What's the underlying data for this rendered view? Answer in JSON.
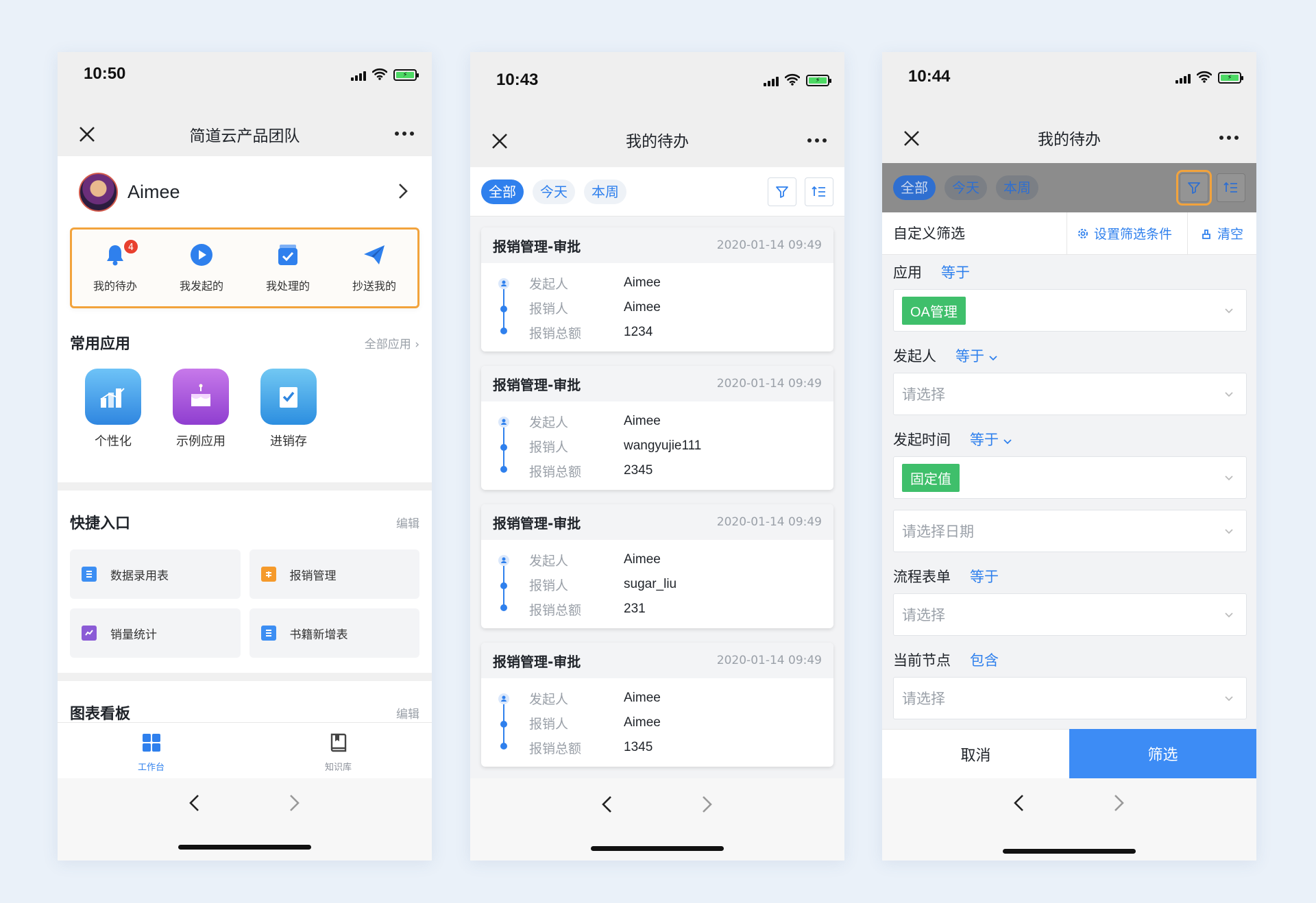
{
  "phone1": {
    "time": "10:50",
    "title": "简道云产品团队",
    "user_name": "Aimee",
    "quick": [
      {
        "label": "我的待办",
        "icon": "bell-icon",
        "badge": "4"
      },
      {
        "label": "我发起的",
        "icon": "play-icon"
      },
      {
        "label": "我处理的",
        "icon": "check-box-icon"
      },
      {
        "label": "抄送我的",
        "icon": "paper-plane-icon"
      }
    ],
    "common_apps": {
      "title": "常用应用",
      "more": "全部应用",
      "items": [
        {
          "label": "个性化",
          "icon": "bar-chart-icon"
        },
        {
          "label": "示例应用",
          "icon": "cake-icon"
        },
        {
          "label": "进销存",
          "icon": "check-doc-icon"
        }
      ]
    },
    "shortcuts": {
      "title": "快捷入口",
      "edit": "编辑",
      "items": [
        {
          "label": "数据录用表",
          "icon": "form-icon"
        },
        {
          "label": "报销管理",
          "icon": "reimburse-icon"
        },
        {
          "label": "销量统计",
          "icon": "monitor-chart-icon"
        },
        {
          "label": "书籍新增表",
          "icon": "form-icon"
        }
      ]
    },
    "dashboard": {
      "title": "图表看板",
      "edit": "编辑"
    },
    "tabs": [
      {
        "label": "工作台",
        "icon": "grid-icon"
      },
      {
        "label": "知识库",
        "icon": "book-icon"
      }
    ]
  },
  "phone2": {
    "time": "10:43",
    "title": "我的待办",
    "chips": [
      "全部",
      "今天",
      "本周"
    ],
    "field_labels": [
      "发起人",
      "报销人",
      "报销总额"
    ],
    "cards": [
      {
        "title": "报销管理-审批",
        "date": "2020-01-14 09:49",
        "values": [
          "Aimee",
          "Aimee",
          "1234"
        ]
      },
      {
        "title": "报销管理-审批",
        "date": "2020-01-14 09:49",
        "values": [
          "Aimee",
          "wangyujie111",
          "2345"
        ]
      },
      {
        "title": "报销管理-审批",
        "date": "2020-01-14 09:49",
        "values": [
          "Aimee",
          "sugar_liu",
          "231"
        ]
      },
      {
        "title": "报销管理-审批",
        "date": "2020-01-14 09:49",
        "values": [
          "Aimee",
          "Aimee",
          "1345"
        ]
      }
    ]
  },
  "phone3": {
    "time": "10:44",
    "title": "我的待办",
    "chips": [
      "全部",
      "今天",
      "本周"
    ],
    "custom_filter": "自定义筛选",
    "set_conditions": "设置筛选条件",
    "clear": "清空",
    "fields": [
      {
        "label": "应用",
        "op": "等于",
        "op_dropdown": false,
        "value_tag": "OA管理",
        "placeholder": ""
      },
      {
        "label": "发起人",
        "op": "等于",
        "op_dropdown": true,
        "value_tag": "",
        "placeholder": "请选择"
      },
      {
        "label": "发起时间",
        "op": "等于",
        "op_dropdown": true,
        "value_tag": "固定值",
        "placeholder": "",
        "extra_placeholder": "请选择日期"
      },
      {
        "label": "流程表单",
        "op": "等于",
        "op_dropdown": false,
        "value_tag": "",
        "placeholder": "请选择"
      },
      {
        "label": "当前节点",
        "op": "包含",
        "op_dropdown": false,
        "value_tag": "",
        "placeholder": "请选择"
      }
    ],
    "cancel": "取消",
    "confirm": "筛选"
  },
  "colors": {
    "accent": "#2f80ed",
    "highlight": "#f2a33c",
    "tag_green": "#3fbf6b",
    "badge_red": "#e8402f"
  }
}
